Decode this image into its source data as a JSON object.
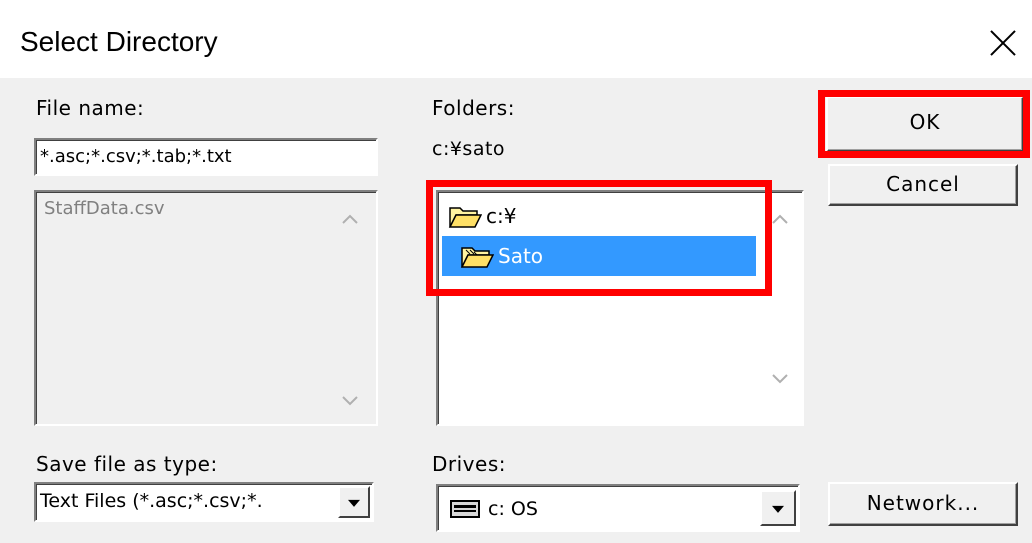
{
  "window": {
    "title": "Select Directory"
  },
  "file_name": {
    "label": "File name:",
    "value": "*.asc;*.csv;*.tab;*.txt",
    "files": [
      "StaffData.csv"
    ]
  },
  "folders": {
    "label": "Folders:",
    "current_path": "c:¥sato",
    "tree": [
      {
        "label": "c:¥",
        "selected": false
      },
      {
        "label": "Sato",
        "selected": true
      }
    ]
  },
  "save_type": {
    "label": "Save file as type:",
    "value": "Text Files (*.asc;*.csv;*."
  },
  "drives": {
    "label": "Drives:",
    "value": "c: OS"
  },
  "buttons": {
    "ok": "OK",
    "cancel": "Cancel",
    "network": "Network..."
  },
  "colors": {
    "selection": "#3399ff",
    "highlight": "#ff0000",
    "dialog_bg": "#f0f0f0"
  },
  "icons": [
    "close-icon",
    "folder-open-icon",
    "folder-icon",
    "drive-icon",
    "chevron-up-icon",
    "chevron-down-icon"
  ]
}
